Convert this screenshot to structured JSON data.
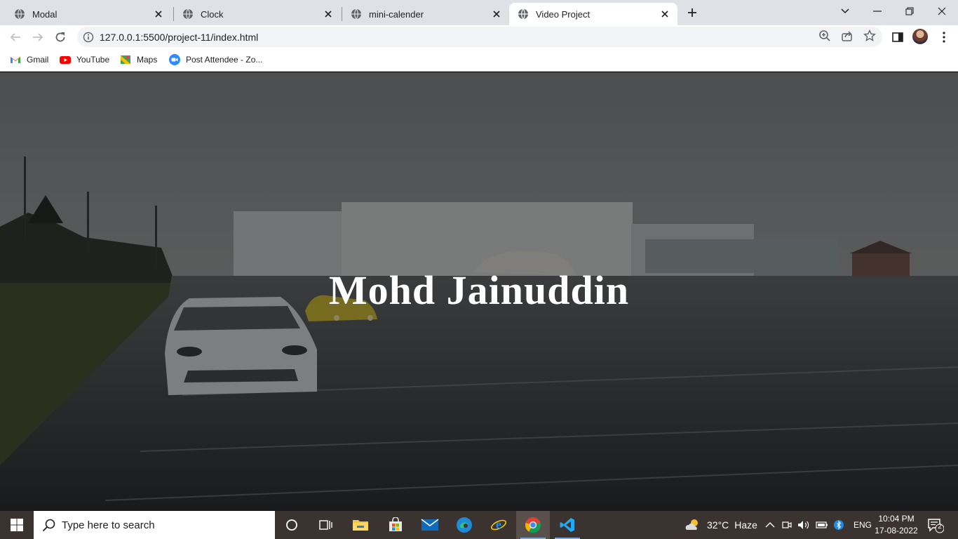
{
  "browser": {
    "tabs": [
      {
        "title": "Modal",
        "active": false
      },
      {
        "title": "Clock",
        "active": false
      },
      {
        "title": "mini-calender",
        "active": false
      },
      {
        "title": "Video Project",
        "active": true
      }
    ],
    "url": "127.0.0.1:5500/project-11/index.html",
    "bookmarks": [
      {
        "label": "Gmail",
        "icon": "gmail-icon"
      },
      {
        "label": "YouTube",
        "icon": "youtube-icon"
      },
      {
        "label": "Maps",
        "icon": "maps-icon"
      },
      {
        "label": "Post Attendee - Zo...",
        "icon": "zoom-icon"
      }
    ]
  },
  "page": {
    "heading": "Mohd Jainuddin",
    "background": "video-background-rainy-parking-lot"
  },
  "taskbar": {
    "search_placeholder": "Type here to search",
    "weather": {
      "temp": "32°C",
      "condition": "Haze"
    },
    "language": "ENG",
    "time": "10:04 PM",
    "date": "17-08-2022",
    "notifications": "2"
  },
  "colors": {
    "tabstrip": "#dee1e6",
    "taskbar": "#3a3330",
    "heading": "#ffffff"
  }
}
